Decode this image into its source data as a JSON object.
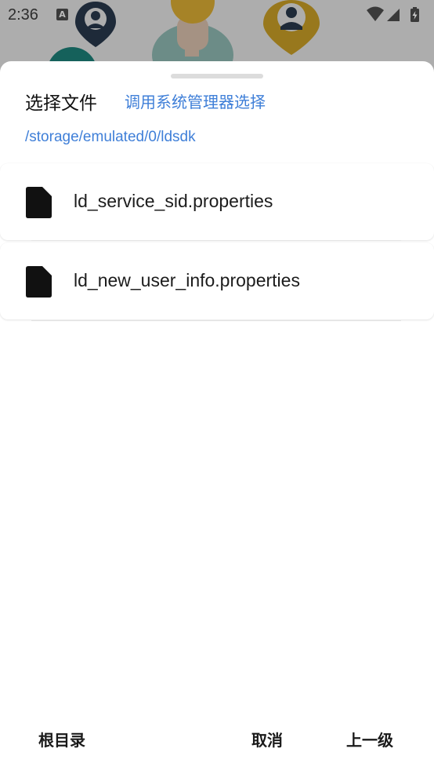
{
  "status_bar": {
    "time": "2:36",
    "notification_icon": "a-letter-icon",
    "notification_letter": "A",
    "icons": [
      "wifi-icon",
      "signal-icon",
      "battery-charging-icon"
    ]
  },
  "sheet": {
    "title": "选择文件",
    "system_picker_label": "调用系统管理器选择",
    "current_path": "/storage/emulated/0/ldsdk",
    "files": [
      {
        "name": "ld_service_sid.properties",
        "icon": "file-icon"
      },
      {
        "name": "ld_new_user_info.properties",
        "icon": "file-icon"
      }
    ],
    "footer": {
      "root_label": "根目录",
      "cancel_label": "取消",
      "up_label": "上一级"
    }
  },
  "colors": {
    "accent": "#3f7fd8",
    "text": "#1c1c1c",
    "scrim": "#000000"
  }
}
